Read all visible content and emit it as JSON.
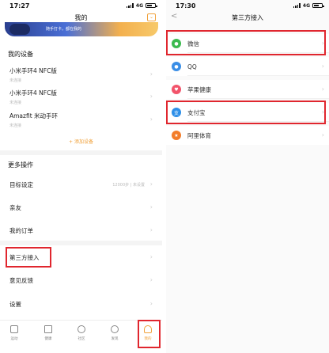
{
  "left_screen": {
    "status_bar": {
      "time": "17:27",
      "network": "4G"
    },
    "nav": {
      "title": "我的"
    },
    "banner": {
      "text": "随手打卡，都在我的"
    },
    "devices_section": {
      "title": "我的设备",
      "devices": [
        {
          "name": "小米手环4 NFC版",
          "status": "未连接"
        },
        {
          "name": "小米手环4 NFC版",
          "status": "未连接"
        },
        {
          "name": "Amazfit 米动手环",
          "status": "未连接"
        }
      ],
      "add_label": "+ 添加设备"
    },
    "more_section": {
      "title": "更多操作",
      "items": [
        {
          "label": "目标设定",
          "value": "12000步 | 未设置"
        },
        {
          "label": "亲友",
          "value": ""
        },
        {
          "label": "我的订单",
          "value": ""
        },
        {
          "label": "第三方接入",
          "value": ""
        },
        {
          "label": "意见反馈",
          "value": ""
        },
        {
          "label": "设置",
          "value": ""
        }
      ]
    },
    "tabbar": {
      "tabs": [
        {
          "label": "运动",
          "icon": "home-icon"
        },
        {
          "label": "健康",
          "icon": "health-icon"
        },
        {
          "label": "社区",
          "icon": "community-icon"
        },
        {
          "label": "发现",
          "icon": "discover-icon"
        },
        {
          "label": "我的",
          "icon": "profile-icon",
          "active": true
        }
      ]
    }
  },
  "right_screen": {
    "status_bar": {
      "time": "17:30",
      "network": "4G"
    },
    "nav": {
      "title": "第三方接入",
      "back": "<"
    },
    "items": [
      {
        "label": "微信",
        "icon": "wechat-icon",
        "color": "#3bba4f"
      },
      {
        "label": "QQ",
        "icon": "qq-icon",
        "color": "#3a8ee6"
      },
      {
        "label": "苹果健康",
        "icon": "apple-health-icon",
        "color": "#f2546b"
      },
      {
        "label": "支付宝",
        "icon": "alipay-icon",
        "color": "#2d8fe8"
      },
      {
        "label": "阿里体育",
        "icon": "ali-sports-icon",
        "color": "#f37d2a"
      }
    ]
  },
  "colors": {
    "accent": "#f0a13a",
    "highlight": "#e0262e"
  }
}
